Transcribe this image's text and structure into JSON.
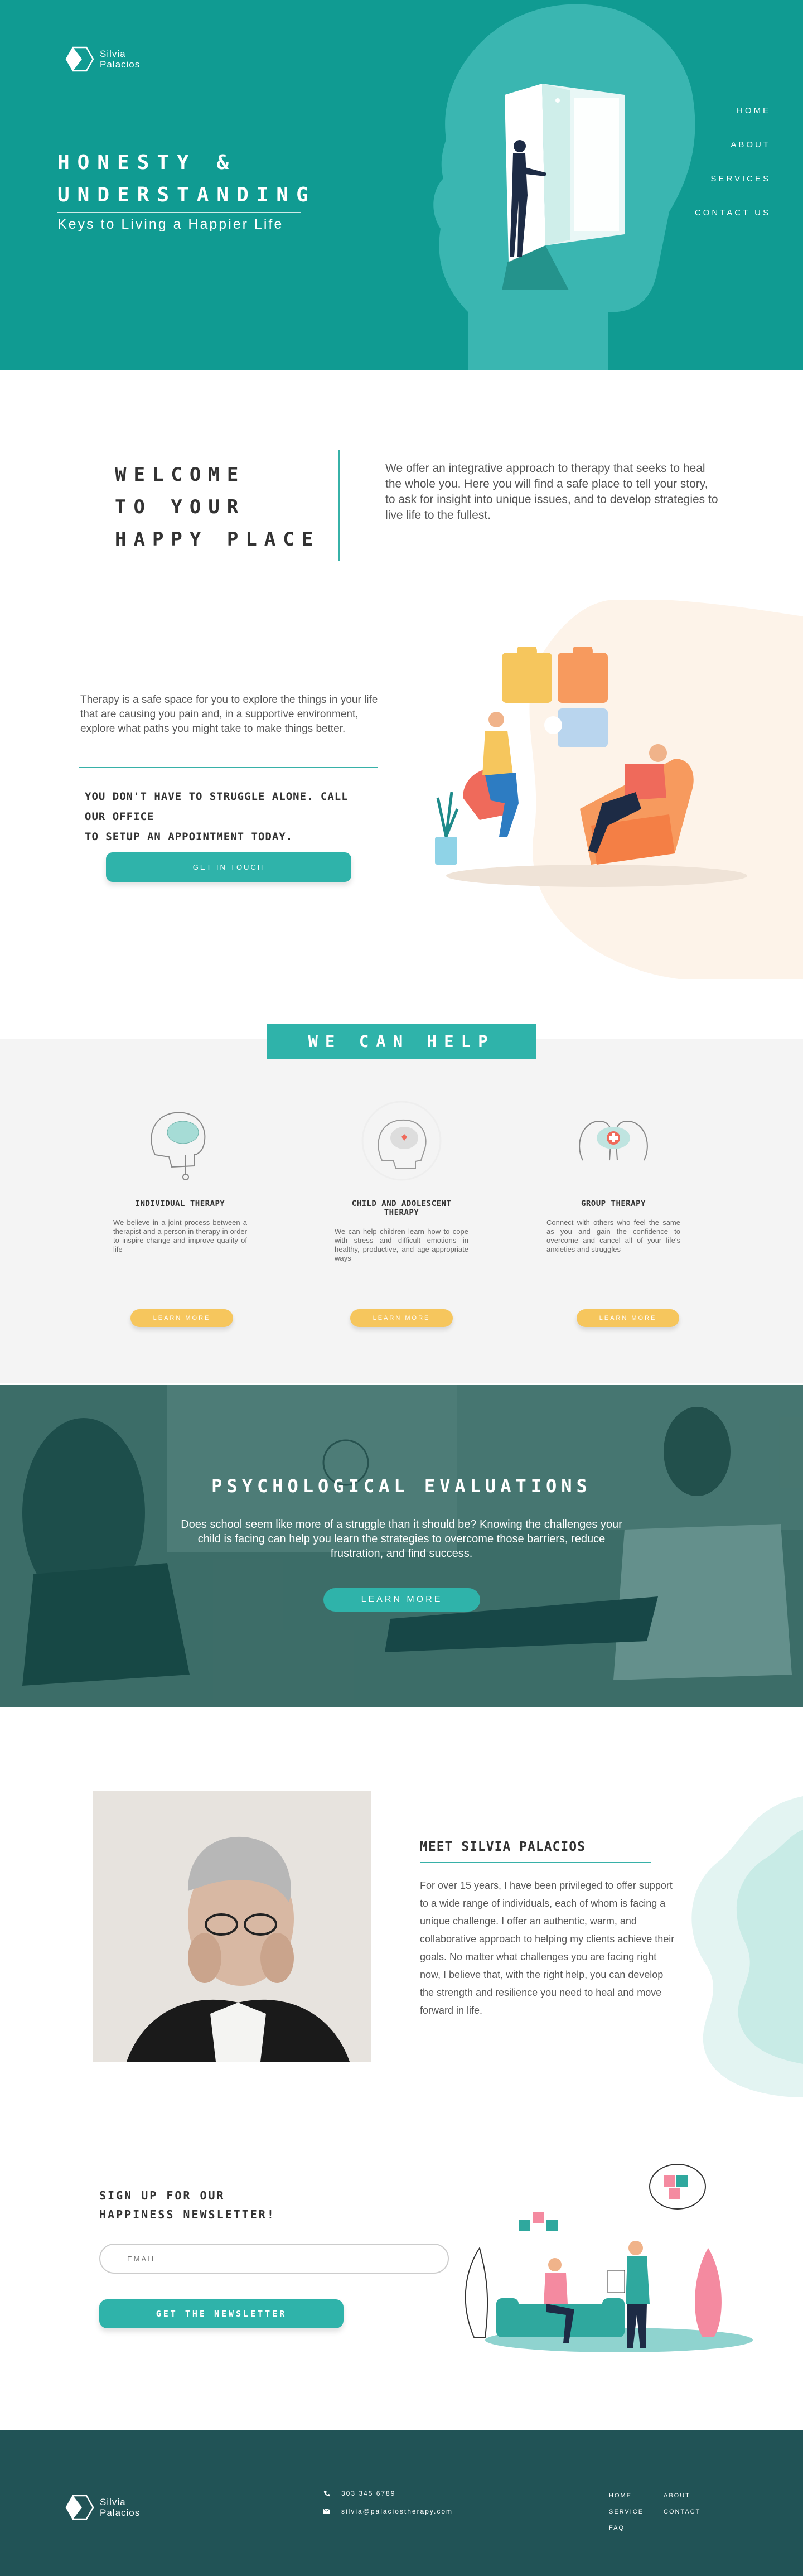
{
  "brand": {
    "name_line1": "Silvia",
    "name_line2": "Palacios"
  },
  "hero": {
    "title_line1": "HONESTY &",
    "title_line2": "UNDERSTANDING",
    "subtitle": "Keys to Living a Happier Life"
  },
  "nav": {
    "items": [
      "HOME",
      "ABOUT",
      "SERVICES",
      "CONTACT US"
    ]
  },
  "welcome": {
    "title_line1": "WELCOME",
    "title_line2": "TO YOUR",
    "title_line3": "HAPPY PLACE",
    "text": "We offer an integrative approach to therapy that seeks to heal the whole you. Here you will find a safe place to tell your story, to ask for insight into unique issues, and to develop strategies to live life to the fullest."
  },
  "safe": {
    "text": "Therapy is a safe space for you to explore the things in your life that are causing you pain and, in a supportive environment, explore what paths you might take to make things better.",
    "cta_line1": "YOU DON'T HAVE TO STRUGGLE ALONE. CALL OUR OFFICE",
    "cta_line2": "TO SETUP AN APPOINTMENT TODAY.",
    "button": "GET IN TOUCH"
  },
  "help": {
    "banner": "WE CAN HELP",
    "services": [
      {
        "title": "INDIVIDUAL THERAPY",
        "desc": "We believe in a joint process between a therapist and a person in therapy in order to inspire change and improve quality of life",
        "button": "LEARN MORE"
      },
      {
        "title": "CHILD AND ADOLESCENT THERAPY",
        "desc": "We can help children learn how to cope with stress and difficult emotions in healthy, productive, and age-appropriate ways",
        "button": "LEARN MORE"
      },
      {
        "title": "GROUP THERAPY",
        "desc": "Connect with others who feel the same as you and gain the confidence to overcome and cancel all of your life's anxieties and struggles",
        "button": "LEARN MORE"
      }
    ]
  },
  "psych": {
    "title": "PSYCHOLOGICAL EVALUATIONS",
    "text": "Does school seem like more of a struggle than it should be? Knowing the challenges your child is facing can help you learn the strategies to overcome those barriers, reduce frustration, and find success.",
    "button": "LEARN MORE"
  },
  "meet": {
    "title": "MEET SILVIA PALACIOS",
    "text": "For over 15 years, I have been privileged to offer support to a wide range of individuals, each of whom is facing a unique challenge. I offer an authentic, warm, and collaborative approach to helping my clients achieve their goals. No matter what challenges you are facing right now, I believe that, with the right help, you can develop the strength and resilience you need to heal and move forward in life."
  },
  "newsletter": {
    "title_line1": "SIGN UP FOR OUR",
    "title_line2": "HAPPINESS NEWSLETTER!",
    "email_placeholder": "EMAIL",
    "button": "GET THE NEWSLETTER"
  },
  "footer": {
    "phone": "303 345 6789",
    "email": "silvia@palaciostherapy.com",
    "links_col1": [
      "HOME",
      "SERVICE",
      "FAQ"
    ],
    "links_col2": [
      "ABOUT",
      "CONTACT"
    ]
  },
  "colors": {
    "teal": "#109b92",
    "button_teal": "#2fb3aa",
    "yellow": "#f6c65d",
    "footer": "#215356",
    "peach": "#fdf3e9"
  },
  "icons": [
    "logo-mark",
    "door-head-illustration",
    "puzzle-illustration",
    "brain-icon",
    "child-head-icon",
    "group-head-icon",
    "phone-icon",
    "mail-icon"
  ]
}
